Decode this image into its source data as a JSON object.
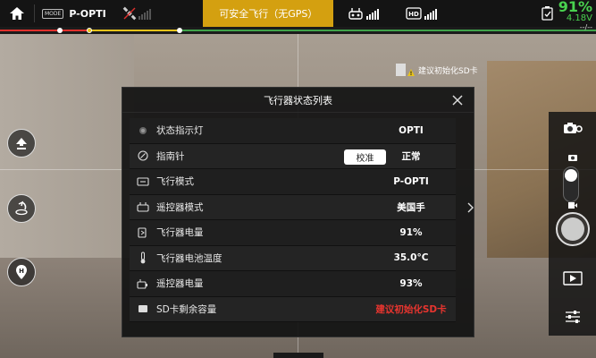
{
  "topbar": {
    "mode_tag": "MODE",
    "flight_mode": "P-OPTI",
    "status_banner": "可安全飞行（无GPS）",
    "battery_percent": "91%",
    "battery_voltage": "4.18V",
    "battery_time": "--/--",
    "colors": {
      "banner": "#d4a010",
      "battery": "#49d14f",
      "track_red": "#e0302d",
      "track_yellow": "#e8c31b",
      "track_green": "#3fa34a"
    }
  },
  "notice": {
    "sd_text": "建议初始化SD卡"
  },
  "dialog": {
    "title": "飞行器状态列表",
    "calibrate_label": "校准",
    "rows": [
      {
        "icon": "status-light-icon",
        "label": "状态指示灯",
        "value": "OPTI",
        "warn": false
      },
      {
        "icon": "compass-icon",
        "label": "指南针",
        "value": "正常",
        "warn": false
      },
      {
        "icon": "flight-mode-icon",
        "label": "飞行模式",
        "value": "P-OPTI",
        "warn": false
      },
      {
        "icon": "remote-controller-icon",
        "label": "遥控器模式",
        "value": "美国手",
        "warn": false
      },
      {
        "icon": "aircraft-battery-icon",
        "label": "飞行器电量",
        "value": "91%",
        "warn": false
      },
      {
        "icon": "thermometer-icon",
        "label": "飞行器电池温度",
        "value": "35.0°C",
        "warn": false
      },
      {
        "icon": "rc-battery-icon",
        "label": "遥控器电量",
        "value": "93%",
        "warn": false
      },
      {
        "icon": "sd-card-icon",
        "label": "SD卡剩余容量",
        "value": "建议初始化SD卡",
        "warn": true
      }
    ]
  }
}
